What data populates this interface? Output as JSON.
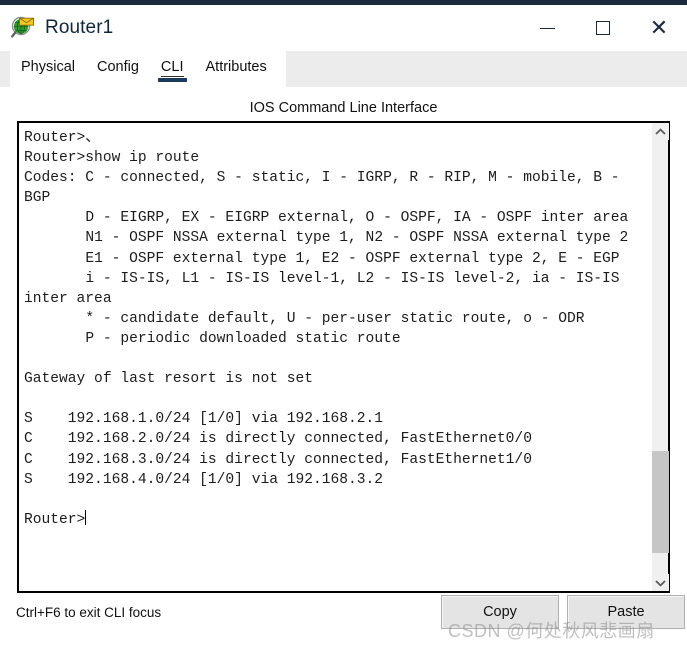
{
  "window": {
    "title": "Router1",
    "icon": "router-device-icon",
    "controls": {
      "minimize": "minimize-icon",
      "maximize": "maximize-icon",
      "close": "close-icon"
    }
  },
  "tabs": [
    {
      "label": "Physical",
      "active": false
    },
    {
      "label": "Config",
      "active": false
    },
    {
      "label": "CLI",
      "active": true
    },
    {
      "label": "Attributes",
      "active": false
    }
  ],
  "panel": {
    "heading": "IOS Command Line Interface"
  },
  "terminal": {
    "prompt": "Router>",
    "lines": [
      "Router>、",
      "Router>show ip route",
      "Codes: C - connected, S - static, I - IGRP, R - RIP, M - mobile, B - BGP",
      "       D - EIGRP, EX - EIGRP external, O - OSPF, IA - OSPF inter area",
      "       N1 - OSPF NSSA external type 1, N2 - OSPF NSSA external type 2",
      "       E1 - OSPF external type 1, E2 - OSPF external type 2, E - EGP",
      "       i - IS-IS, L1 - IS-IS level-1, L2 - IS-IS level-2, ia - IS-IS inter area",
      "       * - candidate default, U - per-user static route, o - ODR",
      "       P - periodic downloaded static route",
      "",
      "Gateway of last resort is not set",
      "",
      "S    192.168.1.0/24 [1/0] via 192.168.2.1",
      "C    192.168.2.0/24 is directly connected, FastEthernet0/0",
      "C    192.168.3.0/24 is directly connected, FastEthernet1/0",
      "S    192.168.4.0/24 [1/0] via 192.168.3.2",
      "",
      "Router>"
    ],
    "routing_table": [
      {
        "code": "S",
        "network": "192.168.1.0/24",
        "metric": "[1/0]",
        "detail": "via 192.168.2.1"
      },
      {
        "code": "C",
        "network": "192.168.2.0/24",
        "metric": "",
        "detail": "is directly connected, FastEthernet0/0"
      },
      {
        "code": "C",
        "network": "192.168.3.0/24",
        "metric": "",
        "detail": "is directly connected, FastEthernet1/0"
      },
      {
        "code": "S",
        "network": "192.168.4.0/24",
        "metric": "[1/0]",
        "detail": "via 192.168.3.2"
      }
    ],
    "scrollbar": {
      "up_arrow": "chevron-up-icon",
      "down_arrow": "chevron-down-icon"
    }
  },
  "footer": {
    "note": "Ctrl+F6 to exit CLI focus",
    "copy_label": "Copy",
    "paste_label": "Paste"
  },
  "watermark": {
    "text": "CSDN @何处秋风悲画扇"
  },
  "colors": {
    "accent": "#1b2a3c",
    "tab_underline": "#1b3a5c",
    "tab_strip_bg": "#ececec",
    "button_bg": "#e4e4e4",
    "scroll_thumb": "#c6c6c6"
  }
}
